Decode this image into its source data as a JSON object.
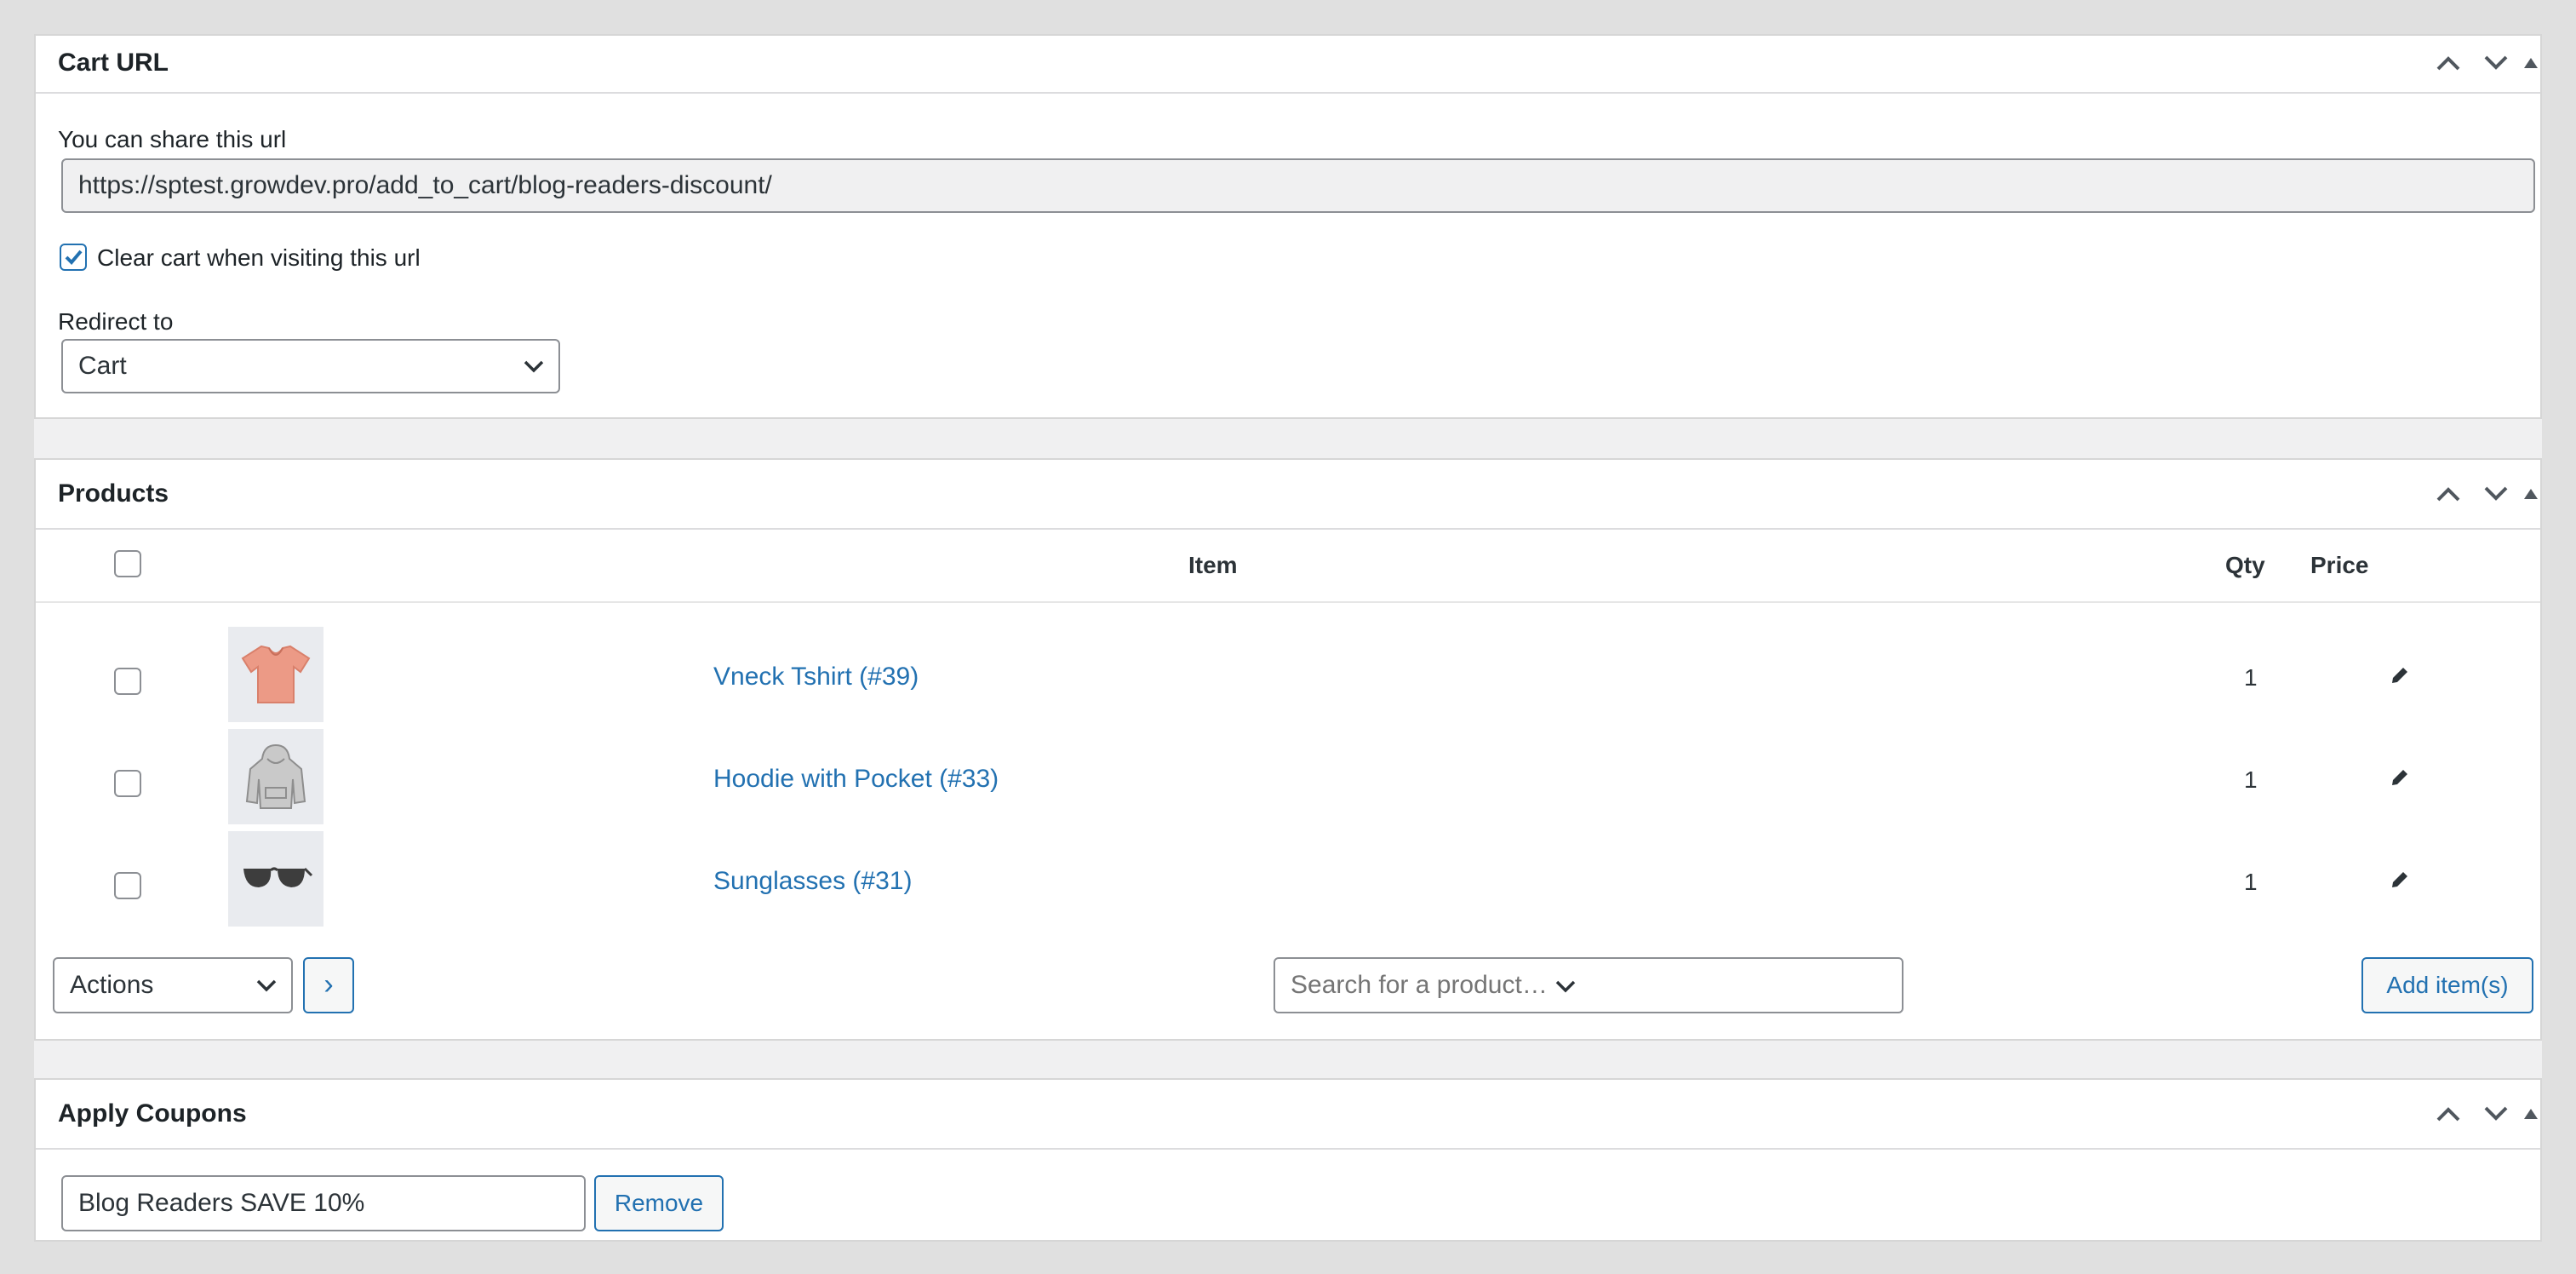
{
  "cart_url_panel": {
    "title": "Cart URL",
    "share_label": "You can share this url",
    "url": "https://sptest.growdev.pro/add_to_cart/blog-readers-discount/",
    "clear_cart_label": "Clear cart when visiting this url",
    "clear_cart_checked": true,
    "redirect_label": "Redirect to",
    "redirect_value": "Cart"
  },
  "products_panel": {
    "title": "Products",
    "columns": {
      "item": "Item",
      "qty": "Qty",
      "price": "Price"
    },
    "rows": [
      {
        "name": "Vneck Tshirt (#39)",
        "qty": "1",
        "thumb": "tshirt-thumbnail"
      },
      {
        "name": "Hoodie with Pocket (#33)",
        "qty": "1",
        "thumb": "hoodie-thumbnail"
      },
      {
        "name": "Sunglasses (#31)",
        "qty": "1",
        "thumb": "sunglasses-thumbnail"
      }
    ],
    "actions_value": "Actions",
    "apply_button": "›",
    "search_placeholder": "Search for a product…",
    "add_items_button": "Add item(s)"
  },
  "coupons_panel": {
    "title": "Apply Coupons",
    "coupon_value": "Blog Readers SAVE 10%",
    "remove_button": "Remove"
  },
  "colors": {
    "accent": "#2271b1",
    "border": "#8c8f94",
    "background": "#e0e0e0"
  }
}
